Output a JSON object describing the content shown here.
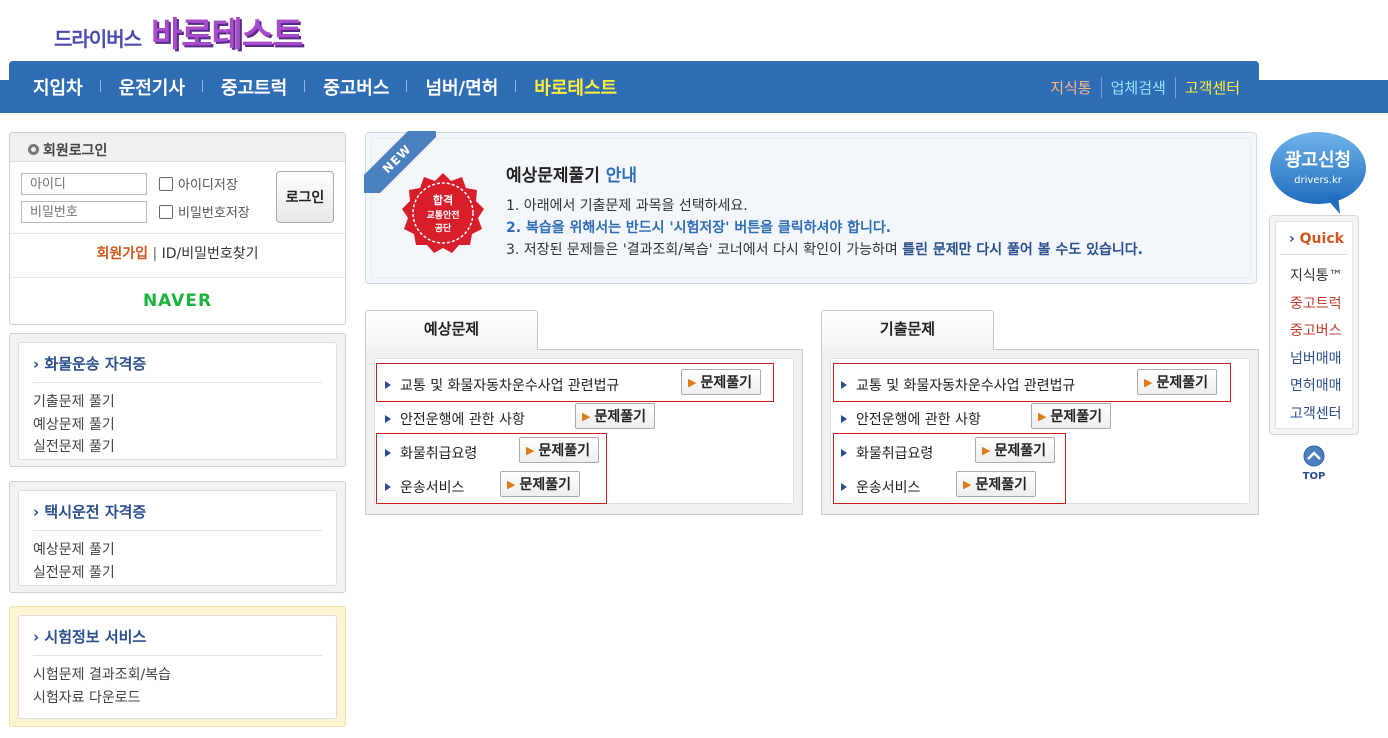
{
  "header": {
    "logo_small": "드라이버스",
    "logo_big": "바로테스트",
    "nav": [
      {
        "label": "지입차"
      },
      {
        "label": "운전기사"
      },
      {
        "label": "중고트럭"
      },
      {
        "label": "중고버스"
      },
      {
        "label": "넘버/면허"
      },
      {
        "label": "바로테스트",
        "active": true
      }
    ],
    "nav_right": [
      {
        "label": "지식통",
        "color": "#ffb58a"
      },
      {
        "label": "업체검색",
        "color": "#8fe7ff"
      },
      {
        "label": "고객센터",
        "color": "#ffef3a"
      }
    ]
  },
  "login": {
    "title": "회원로그인",
    "id_placeholder": "아이디",
    "pw_placeholder": "비밀번호",
    "save_id": "아이디저장",
    "save_pw": "비밀번호저장",
    "login_button": "로그인",
    "join": "회원가입",
    "find": "ID/비밀번호찾기",
    "naver": "NAVER"
  },
  "sections": [
    {
      "title": "화물운송 자격증",
      "links": [
        "기출문제 풀기",
        "예상문제 풀기",
        "실전문제 풀기"
      ]
    },
    {
      "title": "택시운전 자격증",
      "links": [
        "예상문제 풀기",
        "실전문제 풀기"
      ]
    },
    {
      "title": "시험정보 서비스",
      "links": [
        "시험문제 결과조회/복습",
        "시험자료 다운로드"
      ]
    }
  ],
  "notice": {
    "ribbon": "NEW",
    "badge_line1": "합격",
    "badge_line2": "교통안전",
    "badge_line3": "공단",
    "title": "예상문제풀기",
    "title_highlight": "안내",
    "line1": "1. 아래에서 기출문제 과목을 선택하세요.",
    "line2": "2. 복습을 위해서는 반드시 '시험저장' 버튼을 클릭하셔야 합니다.",
    "line3_a": "3. 저장된 문제들은 '결과조회/복습' 코너에서 다시 확인이 가능하며 ",
    "line3_b": "틀린 문제만 다시 풀어 볼 수도 있습니다."
  },
  "panels": [
    {
      "tab": "예상문제",
      "button": "문제풀기",
      "rows": [
        "교통 및 화물자동차운수사업 관련법규",
        "안전운행에 관한 사항",
        "화물취급요령",
        "운송서비스"
      ]
    },
    {
      "tab": "기출문제",
      "button": "문제풀기",
      "rows": [
        "교통 및 화물자동차운수사업 관련법규",
        "안전운행에 관한 사항",
        "화물취급요령",
        "운송서비스"
      ]
    }
  ],
  "quick": {
    "ad_title": "광고신청",
    "ad_sub": "drivers.kr",
    "title": "Quick",
    "items": [
      {
        "label": "지식통™",
        "color": "#333333"
      },
      {
        "label": "중고트럭",
        "color": "#c0392b"
      },
      {
        "label": "중고버스",
        "color": "#c0392b"
      },
      {
        "label": "넘버매매",
        "color": "#2a4f8c"
      },
      {
        "label": "면허매매",
        "color": "#2a4f8c"
      },
      {
        "label": "고객센터",
        "color": "#2a4f8c"
      }
    ],
    "top": "TOP"
  }
}
